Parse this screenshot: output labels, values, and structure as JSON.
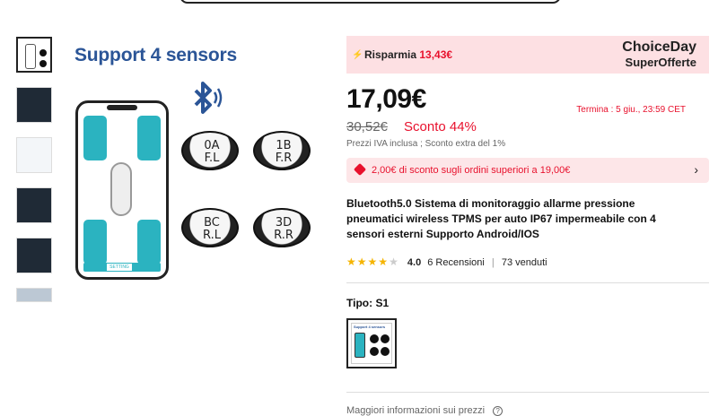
{
  "product_images": {
    "headline": "Support 4 sensors",
    "setting_label": "SETTING",
    "sensor_labels": [
      {
        "top": "0A",
        "bottom": "F.L"
      },
      {
        "top": "1B",
        "bottom": "F.R"
      },
      {
        "top": "BC",
        "bottom": "R.L"
      },
      {
        "top": "3D",
        "bottom": "R.R"
      }
    ]
  },
  "choice_banner": {
    "save_label": "Risparmia",
    "save_amount": "13,43€",
    "brand_line1": "ChoiceDay",
    "brand_line2": "SuperOfferte"
  },
  "price": {
    "current": "17,09€",
    "original": "30,52€",
    "discount": "Sconto 44%",
    "vat_note": "Prezzi IVA inclusa ; Sconto extra del 1%",
    "ends": "Termina :  5 giu., 23:59 CET"
  },
  "coupon": {
    "text": "2,00€ di sconto sugli ordini superiori a 19,00€"
  },
  "product": {
    "title": "Bluetooth5.0 Sistema di monitoraggio allarme pressione pneumatici wireless TPMS per auto IP67 impermeabile con 4 sensori esterni Supporto Android/IOS",
    "rating": 4.0,
    "rating_text": "4.0",
    "reviews": "6 Recensioni",
    "sold": "73 venduti",
    "rating_sep": "|"
  },
  "variant": {
    "label": "Tipo: S1",
    "thumb_text": "Support 4 sensors"
  },
  "footer": {
    "more_info": "Maggiori informazioni sui prezzi",
    "info_icon_glyph": "?"
  },
  "colors": {
    "accent_red": "#e8112d",
    "brand_blue": "#2b5597",
    "teal": "#2bb3c0",
    "banner_pink": "#fde0e3"
  }
}
